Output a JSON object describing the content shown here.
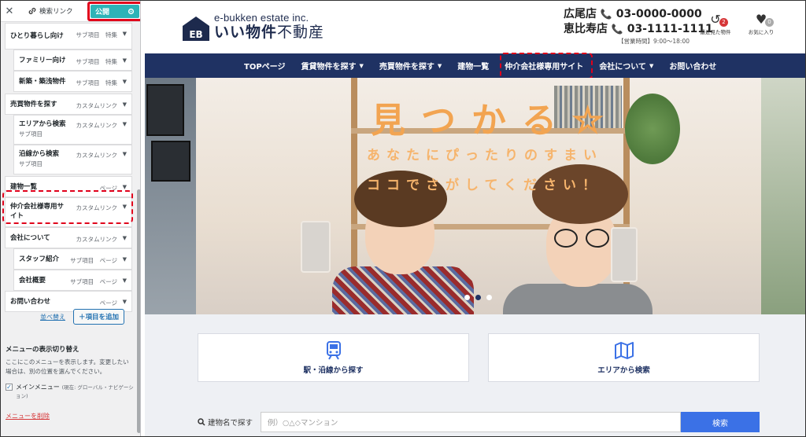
{
  "panel": {
    "close": "✕",
    "search_link": "検索リンク",
    "publish": "公開",
    "menu_items": [
      {
        "title": "ひとり暮らし向け",
        "type": "サブ項目　特集",
        "sub": ""
      },
      {
        "title": "ファミリー向け",
        "type": "サブ項目　特集",
        "sub": ""
      },
      {
        "title": "新築・築浅物件",
        "type": "サブ項目　特集",
        "sub": ""
      },
      {
        "title": "売買物件を探す",
        "type": "カスタムリンク",
        "sub": ""
      },
      {
        "title": "エリアから検索",
        "type": "カスタムリンク",
        "sub": "サブ項目"
      },
      {
        "title": "沿線から検索",
        "type": "カスタムリンク",
        "sub": "サブ項目"
      },
      {
        "title": "建物一覧",
        "type": "ページ",
        "sub": ""
      },
      {
        "title": "仲介会社様専用サイト",
        "type": "カスタムリンク",
        "sub": ""
      },
      {
        "title": "会社について",
        "type": "カスタムリンク",
        "sub": ""
      },
      {
        "title": "スタッフ紹介",
        "type": "サブ項目　ページ",
        "sub": ""
      },
      {
        "title": "会社概要",
        "type": "サブ項目　ページ",
        "sub": ""
      },
      {
        "title": "お問い合わせ",
        "type": "ページ",
        "sub": ""
      }
    ],
    "reorder": "並べ替え",
    "add_item": "項目を追加",
    "display_title": "メニューの表示切り替え",
    "display_desc": "ここにこのメニューを表示します。変更したい場合は、別の位置を選んでください。",
    "main_menu": "メインメニュー",
    "main_menu_loc": "(現在: グローバル・ナビゲーション)",
    "delete_menu": "メニューを削除"
  },
  "site": {
    "logo_sub": "e-bukken estate inc.",
    "logo_main_bold": "いい物件",
    "logo_main_light": "不動産",
    "phones": [
      {
        "store": "広尾店",
        "number": "03-0000-0000"
      },
      {
        "store": "恵比寿店",
        "number": "03-1111-1111"
      }
    ],
    "hours": "【営業時間】9:00〜18:00",
    "recent": {
      "label": "最近見た物件",
      "count": "2"
    },
    "favorites": {
      "label": "お気に入り",
      "count": "0"
    },
    "nav": [
      {
        "label": "TOPページ",
        "dropdown": false
      },
      {
        "label": "賃貸物件を探す",
        "dropdown": true
      },
      {
        "label": "売買物件を探す",
        "dropdown": true
      },
      {
        "label": "建物一覧",
        "dropdown": false
      },
      {
        "label": "仲介会社様専用サイト",
        "dropdown": false
      },
      {
        "label": "会社について",
        "dropdown": true
      },
      {
        "label": "お問い合わせ",
        "dropdown": false
      }
    ],
    "hero": {
      "title": "見つかる",
      "star": "☆",
      "line1": "あなたにぴったりのすまい",
      "line2": "ココでさがしてください！"
    },
    "cards": [
      {
        "label": "駅・沿線から探す"
      },
      {
        "label": "エリアから検索"
      }
    ],
    "search": {
      "label": "建物名で探す",
      "placeholder": "例）○△◇マンション",
      "button": "検索"
    }
  },
  "colors": {
    "publish": "#2db3b7",
    "nav": "#1f3263",
    "highlight": "#e0001b",
    "hero_text": "#f2a451",
    "search_button": "#3b71e6",
    "badge_recent": "#d63638",
    "badge_fav": "#aaaaaa"
  }
}
